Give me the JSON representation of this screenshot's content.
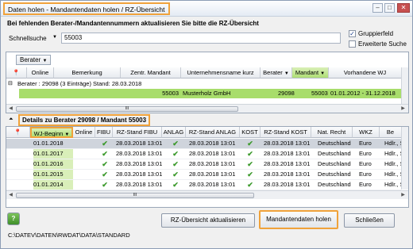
{
  "window": {
    "title": "Daten holen - Mandantendaten holen / RZ-Übersicht",
    "minimize": "–",
    "maximize": "□",
    "close": "✕"
  },
  "instruction": "Bei fehlenden Berater-/Mandantennummern aktualisieren Sie bitte die RZ-Übersicht",
  "search": {
    "label": "Schnellsuche",
    "value": "55003"
  },
  "options": {
    "gruppierfeld": "Gruppierfeld",
    "erweiterte_suche": "Erweiterte Suche"
  },
  "grid1": {
    "group_tab": "Berater",
    "columns": [
      "Online",
      "Bemerkung",
      "Zentr. Mandant",
      "Unternehmensname kurz",
      "Berater",
      "Mandant",
      "Vorhandene WJ"
    ],
    "group_row": "Berater : 29098 (3 Einträge)   Stand: 28.03.2018",
    "row": {
      "zentr_mandant": "55003",
      "unternehmen": "Musterholz GmbH",
      "berater": "29098",
      "mandant": "55003",
      "wj": "01.01.2012 - 31.12.2018"
    },
    "scroll_mark": "III"
  },
  "details": {
    "title": "Details zu Berater 29098 / Mandant 55003",
    "columns": [
      "WJ-Beginn",
      "Online",
      "FIBU",
      "RZ-Stand FIBU",
      "ANLAG",
      "RZ-Stand ANLAG",
      "KOST",
      "RZ-Stand KOST",
      "Nat. Recht",
      "WKZ",
      "Be"
    ],
    "rows": [
      {
        "wj": "01.01.2018",
        "fibu": "✔",
        "rz_fibu": "28.03.2018 13:01",
        "anlag": "✔",
        "rz_anlag": "28.03.2018 13:01",
        "kost": "✔",
        "rz_kost": "28.03.2018 13:01",
        "recht": "Deutschland",
        "wkz": "Euro",
        "be": "Hdlr., S"
      },
      {
        "wj": "01.01.2017",
        "fibu": "✔",
        "rz_fibu": "28.03.2018 13:01",
        "anlag": "✔",
        "rz_anlag": "28.03.2018 13:01",
        "kost": "✔",
        "rz_kost": "28.03.2018 13:01",
        "recht": "Deutschland",
        "wkz": "Euro",
        "be": "Hdlr., S"
      },
      {
        "wj": "01.01.2016",
        "fibu": "✔",
        "rz_fibu": "28.03.2018 13:01",
        "anlag": "✔",
        "rz_anlag": "28.03.2018 13:01",
        "kost": "✔",
        "rz_kost": "28.03.2018 13:01",
        "recht": "Deutschland",
        "wkz": "Euro",
        "be": "Hdlr., S"
      },
      {
        "wj": "01.01.2015",
        "fibu": "✔",
        "rz_fibu": "28.03.2018 13:01",
        "anlag": "✔",
        "rz_anlag": "28.03.2018 13:01",
        "kost": "✔",
        "rz_kost": "28.03.2018 13:01",
        "recht": "Deutschland",
        "wkz": "Euro",
        "be": "Hdlr., S"
      },
      {
        "wj": "01.01.2014",
        "fibu": "✔",
        "rz_fibu": "28.03.2018 13:01",
        "anlag": "✔",
        "rz_anlag": "28.03.2018 13:01",
        "kost": "✔",
        "rz_kost": "28.03.2018 13:01",
        "recht": "Deutschland",
        "wkz": "Euro",
        "be": "Hdlr., S"
      }
    ],
    "scroll_mark": "III"
  },
  "buttons": {
    "help": "?",
    "rz_update": "RZ-Übersicht aktualisieren",
    "fetch": "Mandantendaten holen",
    "close": "Schließen"
  },
  "path": "C:\\DATEV\\DATEN\\RWDAT\\DATA\\STANDARD"
}
